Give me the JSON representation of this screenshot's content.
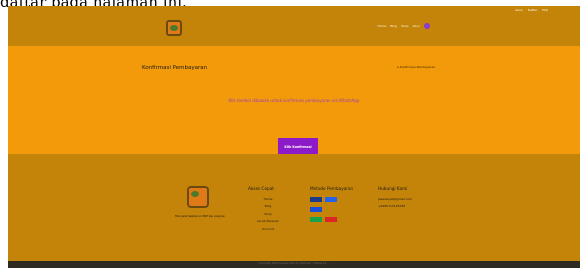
{
  "caption": "daftar pada halaman ini.",
  "header": {
    "top_links": [
      "Akun",
      "Daftar",
      "FAQ"
    ],
    "nav": [
      "Home",
      "Blog",
      "Shop",
      "Akun"
    ]
  },
  "page": {
    "title": "Konfirmasi Pembayaran",
    "breadcrumb": "Konfirmasi Pembayaran",
    "message": "Klik tombol dibawah untuk konfirmasi pembayaran via WhatsApp",
    "button_label": "Klik Konfirmasi"
  },
  "footer": {
    "description": "Toko pada halaman ini fiktif dan yang lain",
    "akses_cepat": {
      "heading": "Akses Cepat",
      "links": [
        "Home",
        "Blog",
        "Shop",
        "Lacak Pesanan",
        "Account"
      ]
    },
    "metode": {
      "heading": "Metode Pembayaran",
      "methods": [
        {
          "name": "BCA",
          "color": "#1e3a8a"
        },
        {
          "name": "Mandiri",
          "color": "#2563eb"
        },
        {
          "name": "BRI",
          "color": "#1d4ed8"
        },
        {
          "name": "Alfamart",
          "color": "#dc2626"
        },
        {
          "name": "Indomaret",
          "color": "#16a34a"
        }
      ]
    },
    "hubungi": {
      "heading": "Hubungi Kami",
      "email": "jasaweyes@gmail.com",
      "phone": "+6285715195785"
    },
    "copyright": "Copyright 2021 Laravel Toko by Rambiel | Theme by ..."
  },
  "colors": {
    "header": "#c4840a",
    "band": "#f29a0a",
    "footer": "#c4840a",
    "button": "#8d1ac9",
    "message": "#a13fb1",
    "bottombar": "#2f2a20"
  }
}
